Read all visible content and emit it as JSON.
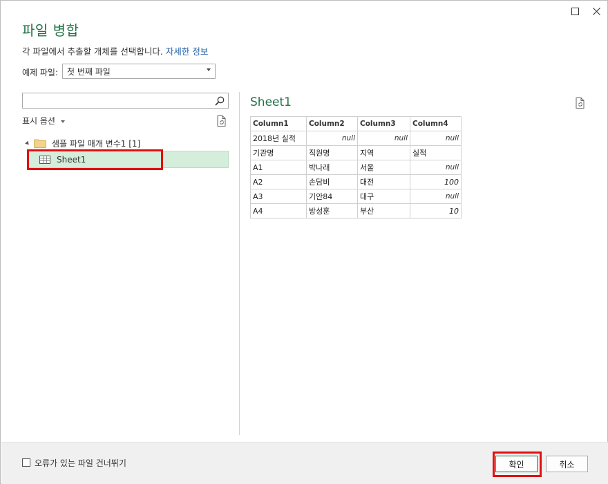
{
  "window": {
    "maximize_icon": "maximize-icon",
    "close_icon": "close-icon"
  },
  "header": {
    "title": "파일 병합",
    "description": "각 파일에서 추출할 개체를 선택합니다.",
    "more_info_link": "자세한 정보"
  },
  "sample_file": {
    "label": "예제 파일:",
    "selected": "첫 번째 파일"
  },
  "search": {
    "placeholder": "",
    "icon": "search-icon"
  },
  "display_options": {
    "label": "표시 옵션"
  },
  "tree": {
    "folder_label": "샘플 파일 매개 변수1 [1]",
    "items": [
      {
        "label": "Sheet1",
        "selected": true
      }
    ]
  },
  "preview": {
    "title": "Sheet1",
    "columns": [
      "Column1",
      "Column2",
      "Column3",
      "Column4"
    ],
    "rows": [
      [
        "2018년 실적",
        "null",
        "null",
        "null"
      ],
      [
        "기관명",
        "직원명",
        "지역",
        "실적"
      ],
      [
        "A1",
        "박나래",
        "서울",
        "null"
      ],
      [
        "A2",
        "손담비",
        "대전",
        "100"
      ],
      [
        "A3",
        "기안84",
        "대구",
        "null"
      ],
      [
        "A4",
        "방성훈",
        "부산",
        "10"
      ]
    ]
  },
  "footer": {
    "skip_errors_label": "오류가 있는 파일 건너뛰기",
    "ok_label": "확인",
    "cancel_label": "취소"
  },
  "colors": {
    "accent": "#217346",
    "selection": "#d5eedb",
    "highlight": "#e01010",
    "link": "#1e5fa8"
  }
}
